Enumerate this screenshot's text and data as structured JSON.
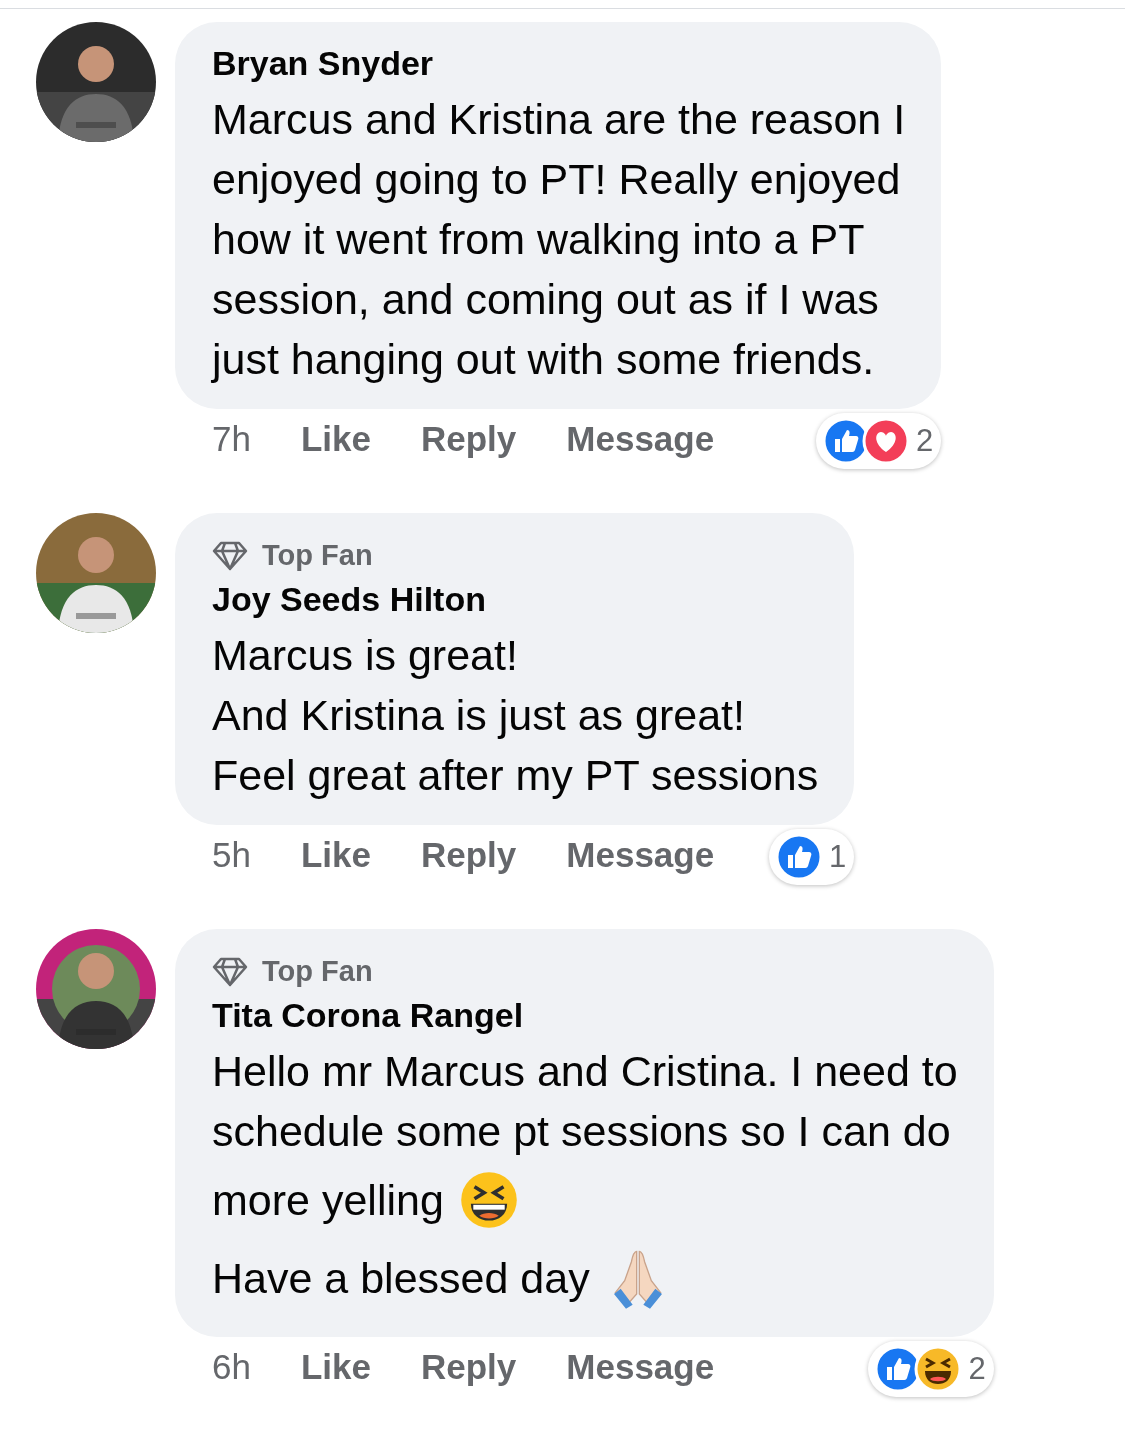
{
  "comments": [
    {
      "author": "Bryan Snyder",
      "avatar": {
        "kind": "picture"
      },
      "lines": [
        {
          "text": "Marcus and Kristina are the reason I"
        },
        {
          "text": "enjoyed going to PT! Really enjoyed"
        },
        {
          "text": "how it went from walking into a PT"
        },
        {
          "text": "session, and coming out as if I was"
        },
        {
          "text": "just hanging out with some friends."
        }
      ],
      "time": "7h",
      "actions": [
        "Like",
        "Reply",
        "Message"
      ],
      "reactions": {
        "icons": [
          {
            "kind": "like"
          },
          {
            "kind": "love"
          }
        ],
        "count": "2"
      }
    },
    {
      "badge": {
        "label": "Top Fan"
      },
      "author": "Joy Seeds Hilton",
      "avatar": {
        "kind": "picture"
      },
      "lines": [
        {
          "text": "Marcus is great!"
        },
        {
          "text": "And Kristina is just as great!"
        },
        {
          "text": "Feel great after my PT sessions"
        }
      ],
      "time": "5h",
      "actions": [
        "Like",
        "Reply",
        "Message"
      ],
      "reactions": {
        "icons": [
          {
            "kind": "like"
          }
        ],
        "count": "1"
      }
    },
    {
      "badge": {
        "label": "Top Fan"
      },
      "author": "Tita Corona Rangel",
      "avatar": {
        "kind": "picture"
      },
      "lines": [
        {
          "text": "Hello mr Marcus and Cristina. I need to"
        },
        {
          "text": "schedule some pt sessions so I can do"
        },
        {
          "text": "more yelling",
          "emoji": {
            "kind": "laughing"
          }
        },
        {
          "text": "Have a blessed day",
          "emoji": {
            "kind": "pray"
          }
        }
      ],
      "time": "6h",
      "actions": [
        "Like",
        "Reply",
        "Message"
      ],
      "reactions": {
        "icons": [
          {
            "kind": "like"
          },
          {
            "kind": "haha"
          }
        ],
        "count": "2"
      }
    }
  ]
}
